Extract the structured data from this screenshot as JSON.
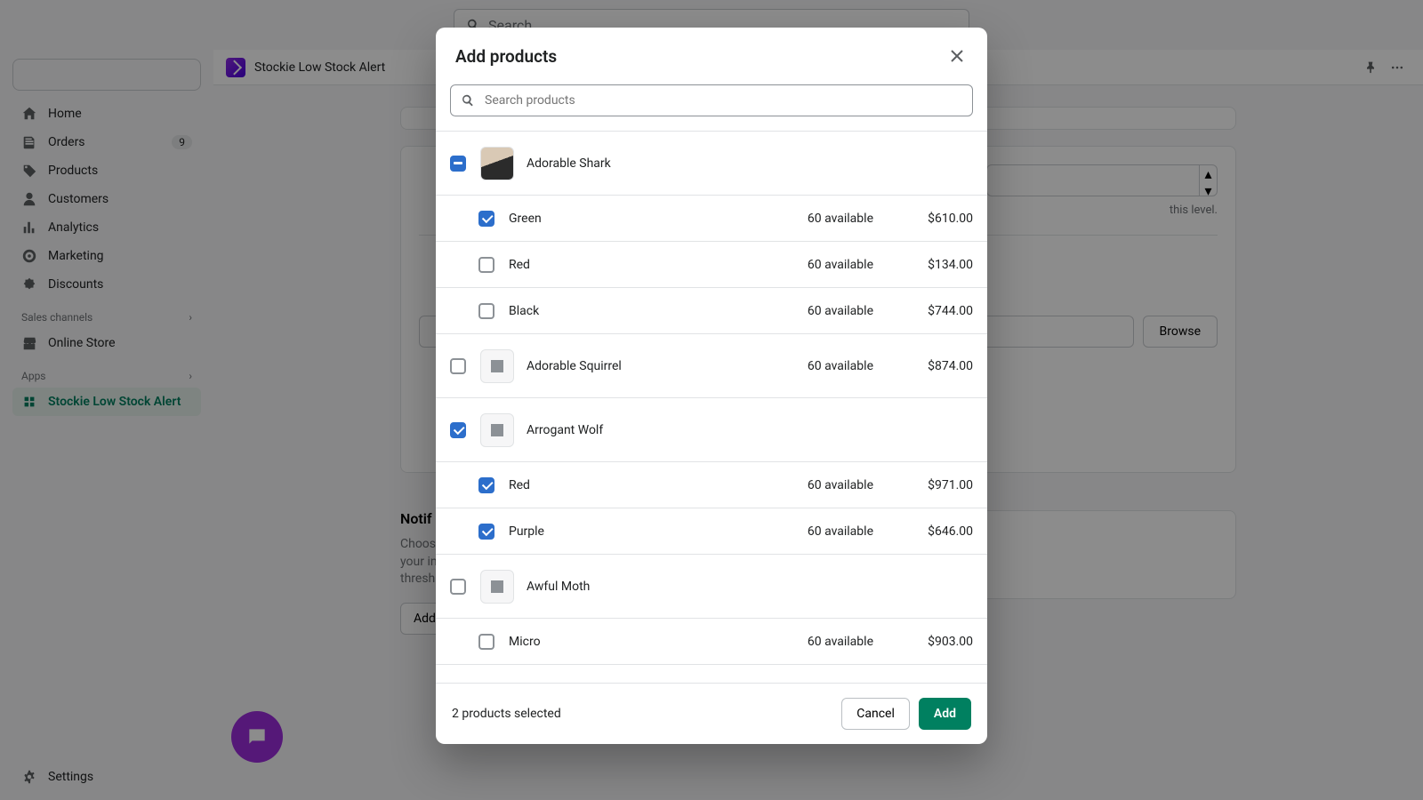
{
  "topbar": {
    "search_placeholder": "Search"
  },
  "sidebar": {
    "items": [
      {
        "label": "Home"
      },
      {
        "label": "Orders",
        "badge": "9"
      },
      {
        "label": "Products"
      },
      {
        "label": "Customers"
      },
      {
        "label": "Analytics"
      },
      {
        "label": "Marketing"
      },
      {
        "label": "Discounts"
      }
    ],
    "section_channels": "Sales channels",
    "online_store": "Online Store",
    "section_apps": "Apps",
    "active_app": "Stockie Low Stock Alert",
    "settings": "Settings"
  },
  "app_header": {
    "title": "Stockie Low Stock Alert"
  },
  "bg": {
    "threshold_note": "this level.",
    "browse_btn": "Browse",
    "notif_title": "Notif",
    "notif_desc1": "Choose",
    "notif_desc2": "your in",
    "notif_desc3": "thresh",
    "add_btn": "Add"
  },
  "modal": {
    "title": "Add products",
    "search_placeholder": "Search products",
    "selected_text": "2 products selected",
    "cancel_label": "Cancel",
    "add_label": "Add",
    "products": [
      {
        "name": "Adorable Shark",
        "state": "indeterminate",
        "has_photo": true,
        "variants": [
          {
            "name": "Green",
            "available": "60 available",
            "price": "$610.00",
            "checked": true
          },
          {
            "name": "Red",
            "available": "60 available",
            "price": "$134.00",
            "checked": false
          },
          {
            "name": "Black",
            "available": "60 available",
            "price": "$744.00",
            "checked": false
          }
        ]
      },
      {
        "name": "Adorable Squirrel",
        "state": "unchecked",
        "has_photo": false,
        "available": "60 available",
        "price": "$874.00",
        "variants": []
      },
      {
        "name": "Arrogant Wolf",
        "state": "checked",
        "has_photo": false,
        "variants": [
          {
            "name": "Red",
            "available": "60 available",
            "price": "$971.00",
            "checked": true
          },
          {
            "name": "Purple",
            "available": "60 available",
            "price": "$646.00",
            "checked": true
          }
        ]
      },
      {
        "name": "Awful Moth",
        "state": "unchecked",
        "has_photo": false,
        "variants": [
          {
            "name": "Micro",
            "available": "60 available",
            "price": "$903.00",
            "checked": false
          }
        ]
      }
    ]
  }
}
